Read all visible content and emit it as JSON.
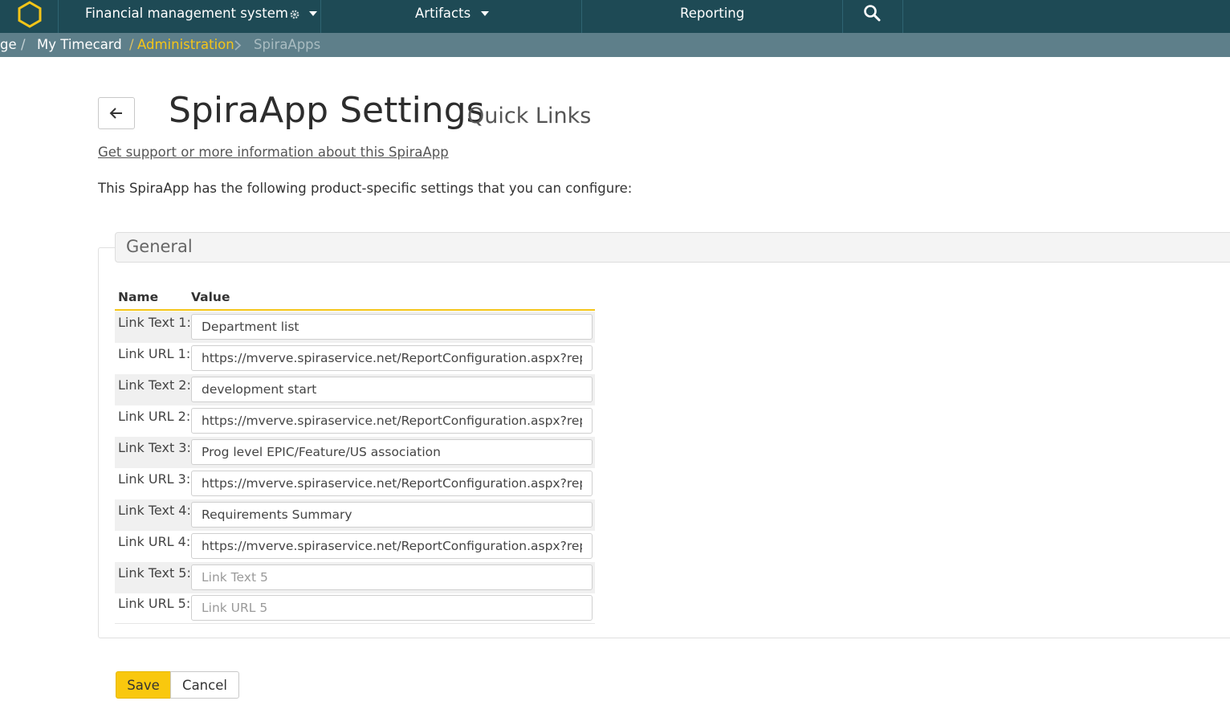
{
  "nav": {
    "project": "Financial management system",
    "artifacts": "Artifacts",
    "reporting": "Reporting"
  },
  "breadcrumb": {
    "partial": "ge",
    "sep": "/",
    "timecard": "My Timecard",
    "admin_sep": "/",
    "administration": "Administration",
    "current": "SpiraApps"
  },
  "header": {
    "title": "SpiraApp Settings",
    "subtitle": "Quick Links",
    "support_link": "Get support or more information about this SpiraApp",
    "intro": "This SpiraApp has the following product-specific settings that you can configure:"
  },
  "settings": {
    "section": "General",
    "col_name": "Name",
    "col_value": "Value",
    "rows": [
      {
        "label": "Link Text 1:",
        "value": "Department list",
        "placeholder": "Link Text 1"
      },
      {
        "label": "Link URL 1:",
        "value": "https://mverve.spiraservice.net/ReportConfiguration.aspx?reportId",
        "placeholder": "Link URL 1"
      },
      {
        "label": "Link Text 2:",
        "value": "development start",
        "placeholder": "Link Text 2"
      },
      {
        "label": "Link URL 2:",
        "value": "https://mverve.spiraservice.net/ReportConfiguration.aspx?reportId",
        "placeholder": "Link URL 2"
      },
      {
        "label": "Link Text 3:",
        "value": "Prog level EPIC/Feature/US association",
        "placeholder": "Link Text 3"
      },
      {
        "label": "Link URL 3:",
        "value": "https://mverve.spiraservice.net/ReportConfiguration.aspx?reportId",
        "placeholder": "Link URL 3"
      },
      {
        "label": "Link Text 4:",
        "value": "Requirements Summary",
        "placeholder": "Link Text 4"
      },
      {
        "label": "Link URL 4:",
        "value": "https://mverve.spiraservice.net/ReportConfiguration.aspx?reportId",
        "placeholder": "Link URL 4"
      },
      {
        "label": "Link Text 5:",
        "value": "",
        "placeholder": "Link Text 5"
      },
      {
        "label": "Link URL 5:",
        "value": "",
        "placeholder": "Link URL 5"
      }
    ]
  },
  "buttons": {
    "save": "Save",
    "cancel": "Cancel"
  },
  "colors": {
    "nav_bg": "#1e4a55",
    "breadcrumb_bg": "#5e7f8a",
    "accent": "#f9c80e",
    "admin_link": "#f5c518"
  },
  "icons": {
    "logo": "hexagon-logo-icon",
    "gear": "gear-icon",
    "search": "search-icon",
    "back": "arrow-left-icon"
  }
}
